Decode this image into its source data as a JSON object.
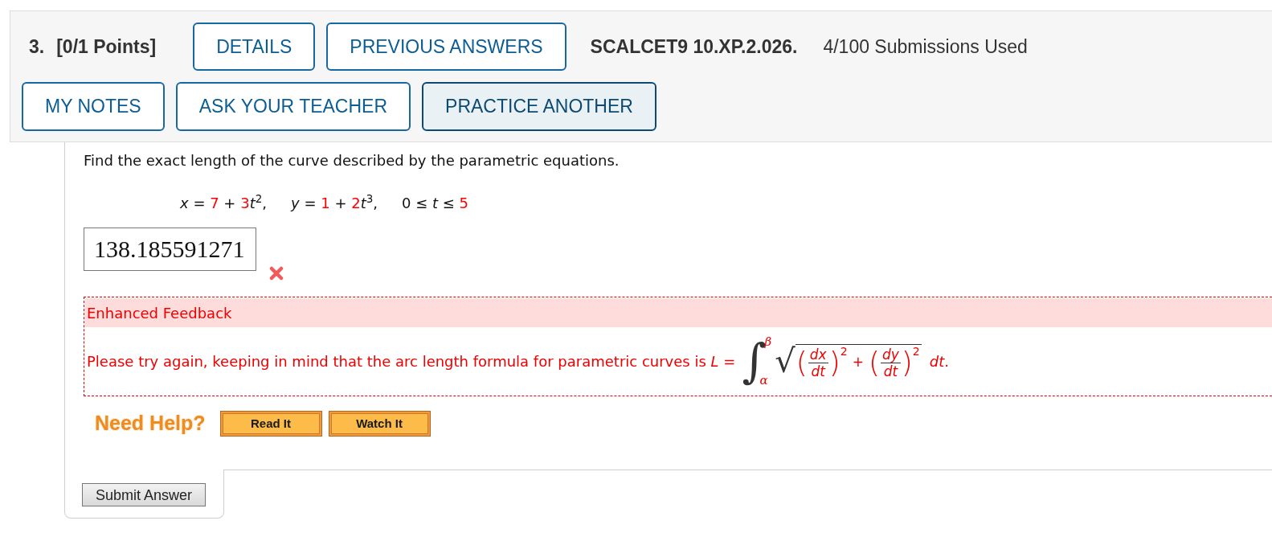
{
  "question": {
    "number": "3.",
    "points": "[0/1 Points]",
    "buttons": [
      {
        "label": "DETAILS",
        "focused": false
      },
      {
        "label": "PREVIOUS ANSWERS",
        "focused": false
      }
    ],
    "code": "SCALCET9 10.XP.2.026.",
    "submissions": "4/100 Submissions Used",
    "tools": [
      {
        "label": "MY NOTES",
        "focused": false
      },
      {
        "label": "ASK YOUR TEACHER",
        "focused": false
      },
      {
        "label": "PRACTICE ANOTHER",
        "focused": true
      }
    ]
  },
  "prompt": "Find the exact length of the curve described by the parametric equations.",
  "equations": [
    {
      "segments": [
        {
          "kind": "plain",
          "text": "*x* = "
        },
        {
          "kind": "value",
          "text": "7"
        },
        {
          "kind": "plain",
          "text": " + "
        },
        {
          "kind": "value",
          "text": "3"
        },
        {
          "kind": "plain",
          "text": "*t*$^{2}$,"
        }
      ]
    },
    {
      "segments": [
        {
          "kind": "plain",
          "text": "*y* = "
        },
        {
          "kind": "value",
          "text": "1"
        },
        {
          "kind": "plain",
          "text": " + "
        },
        {
          "kind": "value",
          "text": "2"
        },
        {
          "kind": "plain",
          "text": "*t*$^{3}$,"
        }
      ]
    },
    {
      "segments": [
        {
          "kind": "plain",
          "text": "0 ≤ *t* ≤ "
        },
        {
          "kind": "value",
          "text": "5"
        }
      ]
    }
  ],
  "answer": {
    "value": "138.185591271",
    "correct": false
  },
  "feedback": {
    "title": "Enhanced Feedback",
    "text": "Please try again, keeping in mind that the arc length formula for parametric curves is *L* =",
    "formula": {
      "integral": "∫",
      "upper": "β",
      "lower": "α",
      "radical": "√",
      "terms": [
        {
          "open": "(",
          "numerator": "dx",
          "denominator": "dt",
          "close": ")",
          "exponent": "2"
        },
        {
          "open": "(",
          "numerator": "dy",
          "denominator": "dt",
          "close": ")",
          "exponent": "2"
        }
      ],
      "operator": "+",
      "differential": "dt",
      "end": "."
    }
  },
  "help": {
    "label": "Need Help?",
    "buttons": [
      "Read It",
      "Watch It"
    ]
  },
  "submit": {
    "label": "Submit Answer"
  }
}
